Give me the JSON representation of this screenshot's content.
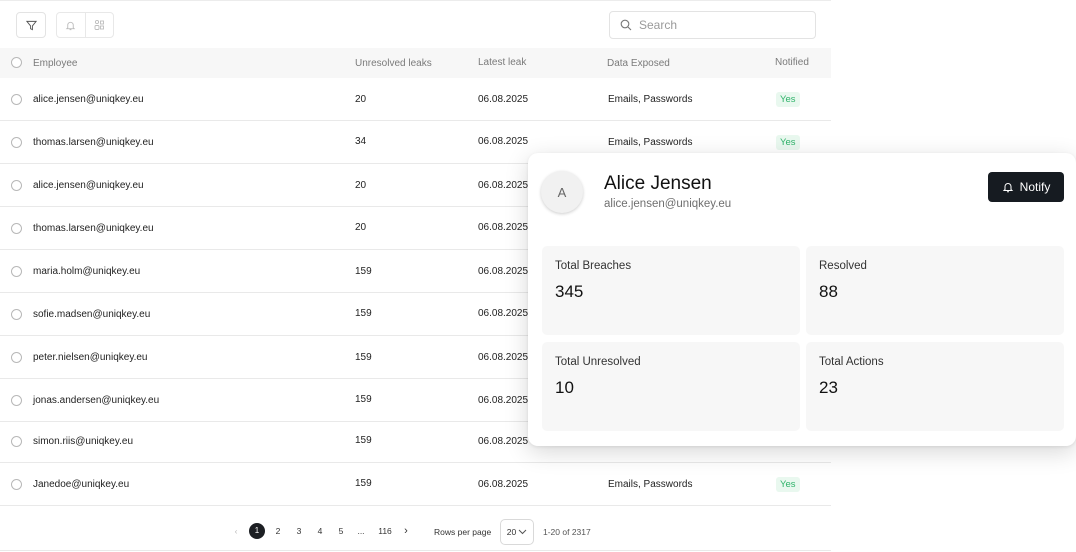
{
  "toolbar": {
    "filter_icon": "filter-icon",
    "bell_icon": "bell-icon",
    "group_icon": "group-icon",
    "search_icon": "search-icon",
    "search_placeholder": "Search",
    "search_value": ""
  },
  "table": {
    "columns": {
      "employee": "Employee",
      "unresolved": "Unresolved leaks",
      "latest": "Latest leak",
      "exposed": "Data Exposed",
      "notified": "Notified"
    },
    "rows": [
      {
        "email": "alice.jensen@uniqkey.eu",
        "unresolved": "20",
        "latest": "06.08.2025",
        "exposed": "Emails, Passwords",
        "notified": "Yes"
      },
      {
        "email": "thomas.larsen@uniqkey.eu",
        "unresolved": "34",
        "latest": "06.08.2025",
        "exposed": "Emails, Passwords",
        "notified": "Yes"
      },
      {
        "email": "alice.jensen@uniqkey.eu",
        "unresolved": "20",
        "latest": "06.08.2025",
        "exposed": "",
        "notified": ""
      },
      {
        "email": "thomas.larsen@uniqkey.eu",
        "unresolved": "20",
        "latest": "06.08.2025",
        "exposed": "",
        "notified": ""
      },
      {
        "email": "maria.holm@uniqkey.eu",
        "unresolved": "159",
        "latest": "06.08.2025",
        "exposed": "",
        "notified": ""
      },
      {
        "email": "sofie.madsen@uniqkey.eu",
        "unresolved": "159",
        "latest": "06.08.2025",
        "exposed": "",
        "notified": ""
      },
      {
        "email": "peter.nielsen@uniqkey.eu",
        "unresolved": "159",
        "latest": "06.08.2025",
        "exposed": "",
        "notified": ""
      },
      {
        "email": "jonas.andersen@uniqkey.eu",
        "unresolved": "159",
        "latest": "06.08.2025",
        "exposed": "",
        "notified": ""
      },
      {
        "email": "simon.riis@uniqkey.eu",
        "unresolved": "159",
        "latest": "06.08.2025",
        "exposed": "",
        "notified": ""
      },
      {
        "email": "Janedoe@uniqkey.eu",
        "unresolved": "159",
        "latest": "06.08.2025",
        "exposed": "Emails, Passwords",
        "notified": "Yes"
      }
    ]
  },
  "pagination": {
    "prev": "‹",
    "pages": [
      "1",
      "2",
      "3",
      "4",
      "5"
    ],
    "ellipsis": "...",
    "last": "116",
    "next": "›",
    "rows_per_page_label": "Rows per page",
    "rows_per_page_value": "20",
    "range_text": "1-20 of 2317"
  },
  "popup": {
    "avatar_initial": "A",
    "name": "Alice Jensen",
    "email": "alice.jensen@uniqkey.eu",
    "notify_label": "Notify",
    "stats": [
      {
        "label": "Total Breaches",
        "value": "345"
      },
      {
        "label": "Resolved",
        "value": "88"
      },
      {
        "label": "Total Unresolved",
        "value": "10"
      },
      {
        "label": "Total Actions",
        "value": "23"
      }
    ]
  },
  "colors": {
    "badge_bg": "#e9f8ef",
    "badge_text": "#2fb36a",
    "primary_button": "#161b21"
  }
}
